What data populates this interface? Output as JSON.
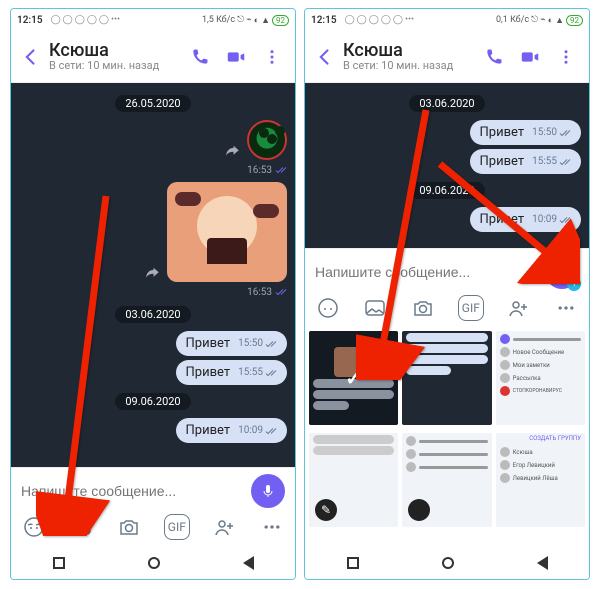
{
  "status": {
    "time": "12:15",
    "net_left": "1,5 Кб/с",
    "net_right": "0,1 Кб/с",
    "battery": "92"
  },
  "header": {
    "name": "Ксюша",
    "status": "В сети: 10 мин. назад"
  },
  "dates": {
    "d1": "26.05.2020",
    "d2": "03.06.2020",
    "d3": "09.06.2020"
  },
  "times": {
    "t1": "16:53",
    "t2": "16:53",
    "m1": "15:50",
    "m2": "15:55",
    "m3": "10:09"
  },
  "msgs": {
    "hi": "Привет"
  },
  "input": {
    "placeholder": "Напишите сообщение...",
    "gif": "GIF"
  },
  "send": {
    "count": "1"
  },
  "thumbs": {
    "t3_lines": [
      "Новое Сообщение",
      "Мои заметки",
      "Рассылка",
      "СТОПКОРОНАВИРУС"
    ],
    "t6_lines": [
      "Ксюша",
      "Егор Левицкий",
      "Левицкий Лёша"
    ],
    "t6_action": "СОЗДАТЬ ГРУППУ"
  }
}
